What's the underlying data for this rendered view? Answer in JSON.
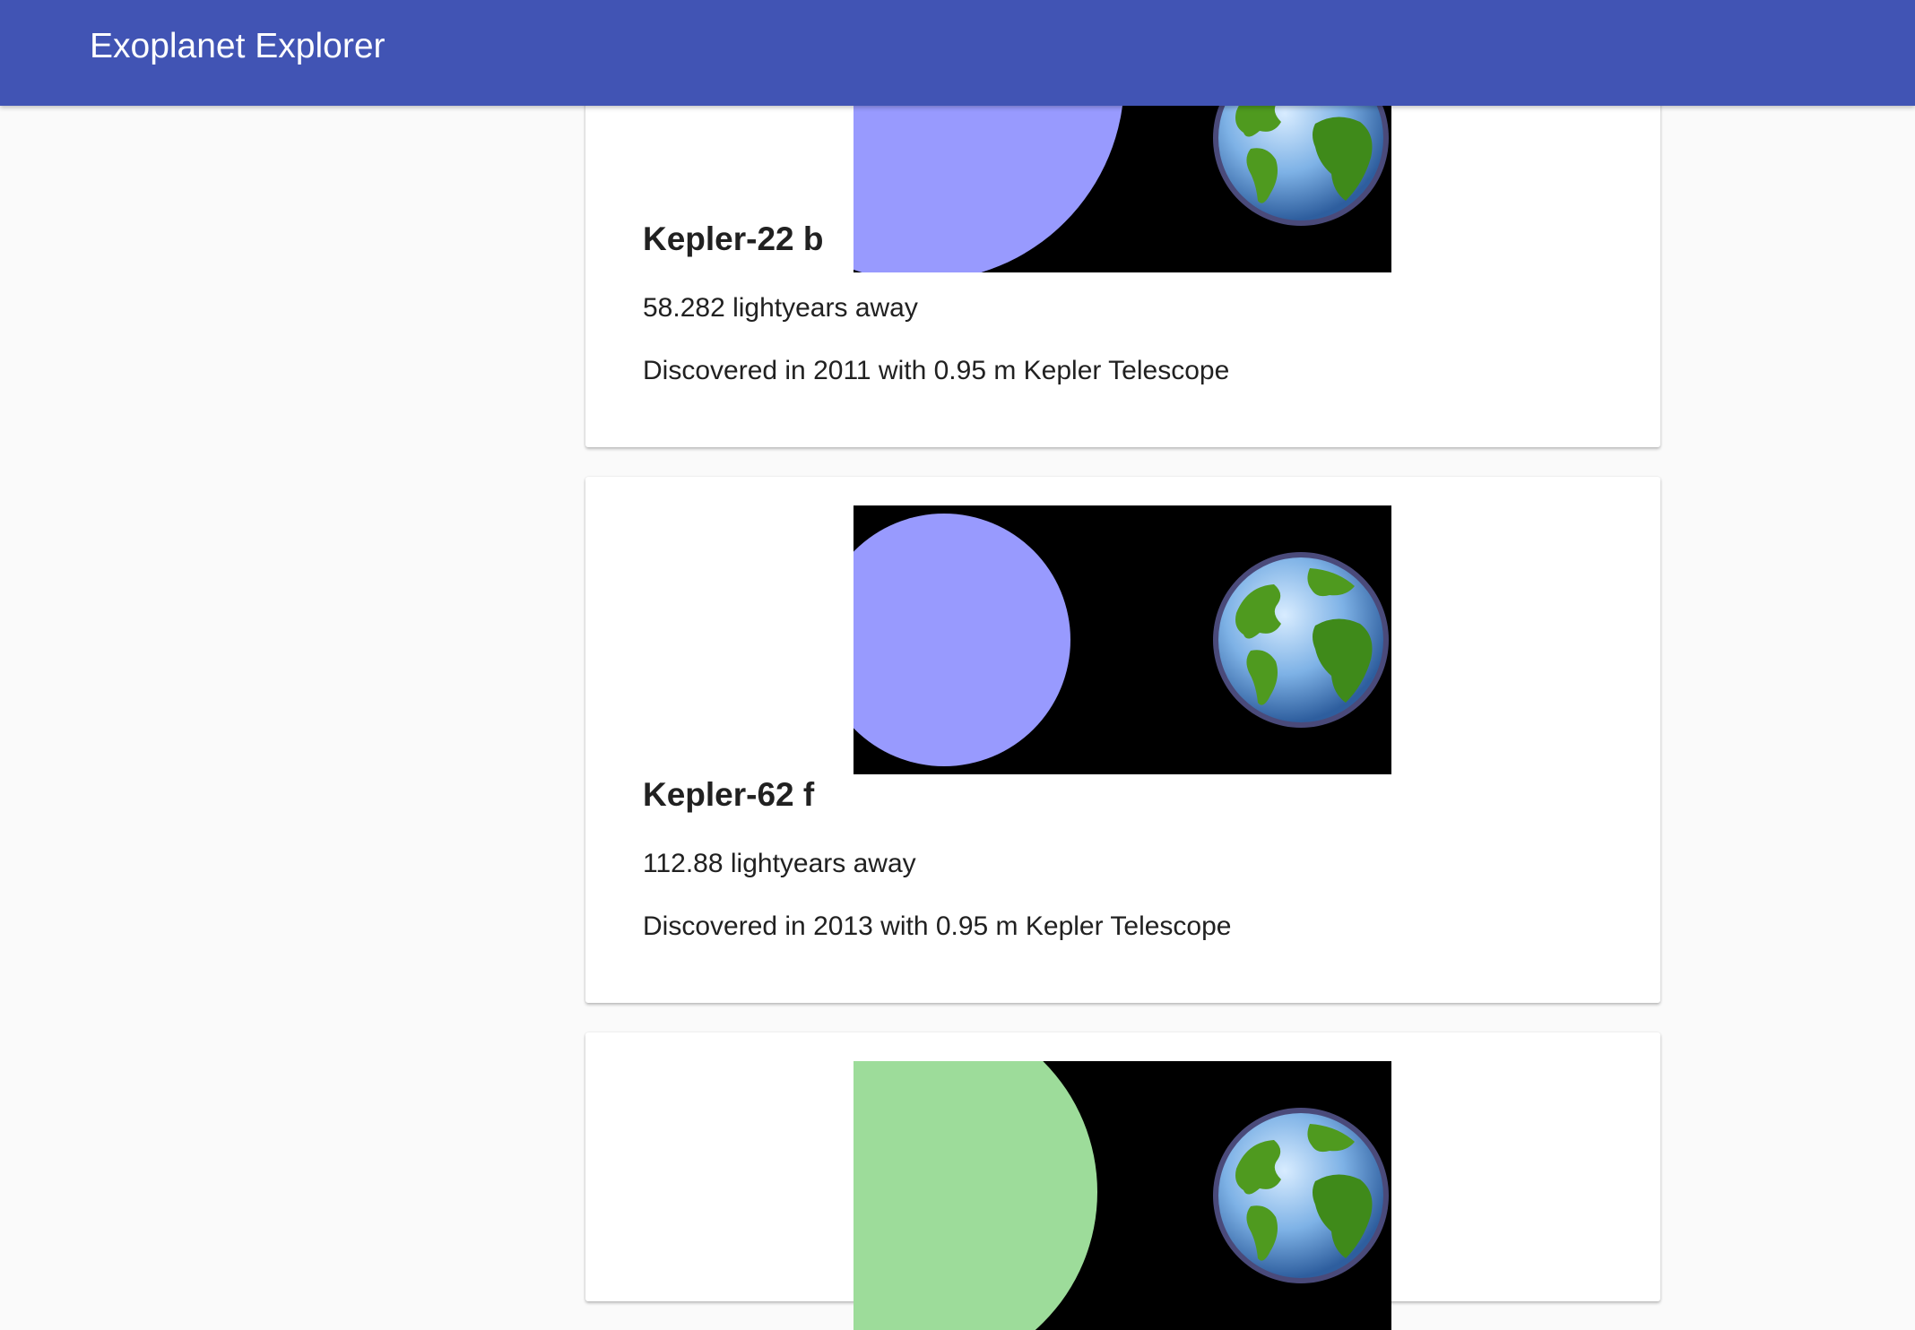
{
  "app": {
    "title": "Exoplanet Explorer"
  },
  "planets": [
    {
      "name": "Kepler-22 b",
      "distance_text": "58.282 lightyears away",
      "discovery_text": "Discovered in 2011 with 0.95 m Kepler Telescope",
      "planet_color": "#989afe",
      "icon": "earth-icon"
    },
    {
      "name": "Kepler-62 f",
      "distance_text": "112.88 lightyears away",
      "discovery_text": "Discovered in 2013 with 0.95 m Kepler Telescope",
      "planet_color": "#989afe",
      "icon": "earth-icon"
    },
    {
      "name": "",
      "distance_text": "",
      "discovery_text": "",
      "planet_color": "#9ddc9a",
      "icon": "earth-icon"
    }
  ],
  "colors": {
    "appbar": "#4154b4",
    "background": "#fafafa"
  }
}
